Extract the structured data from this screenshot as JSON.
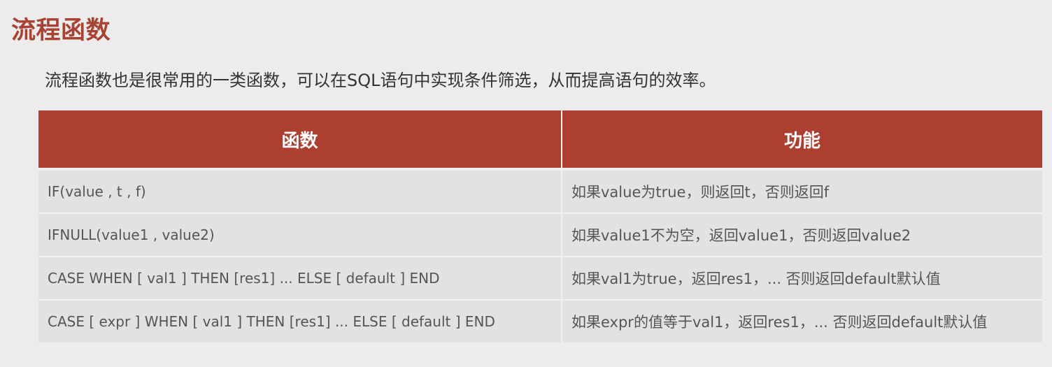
{
  "slide": {
    "title": "流程函数",
    "subtitle": "流程函数也是很常用的一类函数，可以在SQL语句中实现条件筛选，从而提高语句的效率。"
  },
  "table": {
    "headers": [
      "函数",
      "功能"
    ],
    "rows": [
      {
        "function": "IF(value , t , f)",
        "description": "如果value为true，则返回t，否则返回f"
      },
      {
        "function": "IFNULL(value1 , value2)",
        "description": "如果value1不为空，返回value1，否则返回value2"
      },
      {
        "function": "CASE  WHEN  [ val1 ]  THEN  [res1]  ... ELSE [ default ]  END",
        "description": "如果val1为true，返回res1，... 否则返回default默认值"
      },
      {
        "function": "CASE [ expr ]  WHEN  [ val1 ]  THEN  [res1]  ... ELSE [ default ]  END",
        "description": "如果expr的值等于val1，返回res1，... 否则返回default默认值"
      }
    ]
  },
  "colors": {
    "background": "#ececec",
    "accent": "#a84233",
    "header_bg": "#ac3f30",
    "row_bg": "#e2e2e2",
    "text": "#333333"
  }
}
